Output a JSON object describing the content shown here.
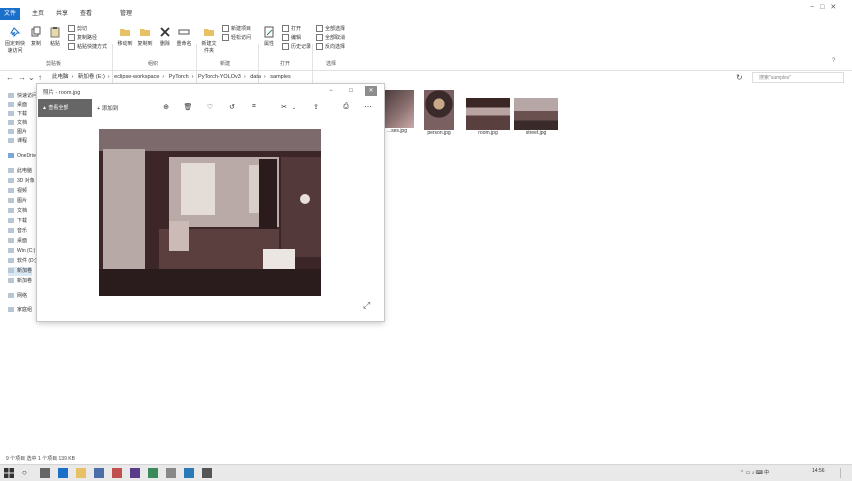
{
  "ribbon_tabs": [
    "文件",
    "主页",
    "共享",
    "查看",
    "管理"
  ],
  "ribbon": {
    "pin_label": "固定到快速访问",
    "copy_label": "复制",
    "paste_label": "粘贴",
    "cut_label": "剪切",
    "copy_path_label": "复制路径",
    "paste_shortcut_label": "粘贴快捷方式",
    "move_label": "移动到",
    "copyto_label": "复制到",
    "delete_label": "删除",
    "rename_label": "重命名",
    "new_folder_label": "新建文件夹",
    "new_item_label": "新建项目",
    "easy_access_label": "轻松访问",
    "properties_label": "属性",
    "open_label": "打开",
    "edit_label": "编辑",
    "history_label": "历史记录",
    "select_all_label": "全部选择",
    "select_none_label": "全部取消",
    "invert_label": "反向选择",
    "groups": {
      "clipboard": "剪贴板",
      "organize": "组织",
      "new": "新建",
      "open": "打开",
      "select": "选择"
    }
  },
  "address": {
    "crumbs": [
      "此电脑",
      "新加卷 (E:)",
      "eclipse-workspace",
      "PyTorch",
      "PyTorch-YOLOv3",
      "data",
      "samples"
    ],
    "search_placeholder": "搜索\"samples\""
  },
  "nav": {
    "items": [
      "快速访问",
      "桌面",
      "下载",
      "文档",
      "图片",
      "课程",
      "OneDrive",
      "此电脑",
      "3D 对象",
      "视频",
      "图片",
      "文档",
      "下载",
      "音乐",
      "桌面",
      "Win (C:)",
      "软件 (D:)",
      "新加卷",
      "新加卷",
      "网络",
      "家庭组"
    ]
  },
  "thumbnails": [
    {
      "label": "...ses.jpg"
    },
    {
      "label": "person.jpg"
    },
    {
      "label": "room.jpg"
    },
    {
      "label": "street.jpg"
    }
  ],
  "photos": {
    "title": "照片 - room.jpg",
    "view_all": "查看全部",
    "add_to": "添加到"
  },
  "status": {
    "text": "9 个项目    选中 1 个项目  139 KB"
  },
  "taskbar": {
    "clock_time": "14:56"
  }
}
